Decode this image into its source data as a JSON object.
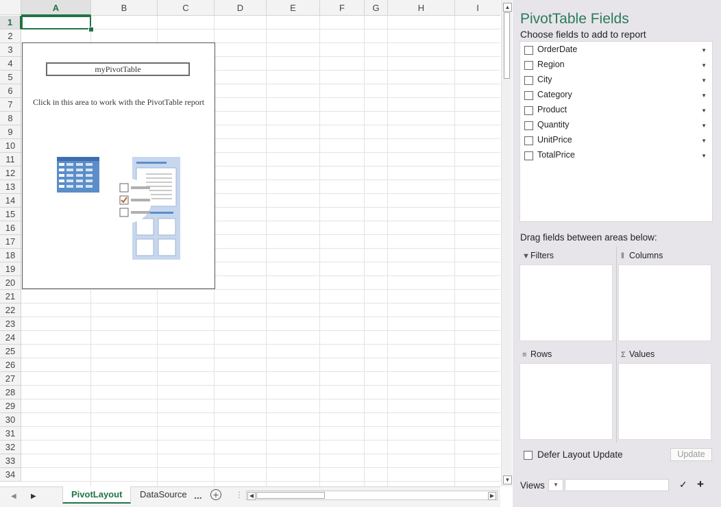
{
  "sheet": {
    "columns": [
      {
        "label": "A",
        "w": 102
      },
      {
        "label": "B",
        "w": 97
      },
      {
        "label": "C",
        "w": 83
      },
      {
        "label": "D",
        "w": 76
      },
      {
        "label": "E",
        "w": 78
      },
      {
        "label": "F",
        "w": 65
      },
      {
        "label": "G",
        "w": 34
      },
      {
        "label": "H",
        "w": 98
      },
      {
        "label": "I",
        "w": 67
      }
    ],
    "rows": [
      "1",
      "2",
      "3",
      "4",
      "5",
      "6",
      "7",
      "8",
      "9",
      "10",
      "11",
      "12",
      "13",
      "14",
      "15",
      "16",
      "17",
      "18",
      "19",
      "20",
      "21",
      "22",
      "23",
      "24",
      "25",
      "26",
      "27",
      "28",
      "29",
      "30",
      "31",
      "32",
      "33",
      "34"
    ],
    "selected_cell": "A1"
  },
  "pivot_placeholder": {
    "title": "myPivotTable",
    "hint": "Click in this area to work with the PivotTable report"
  },
  "tabs": {
    "items": [
      "PivotLayout",
      "DataSource"
    ],
    "active": "PivotLayout",
    "more_label": "...",
    "add_label": "+"
  },
  "panel": {
    "title": "PivotTable Fields",
    "subtitle": "Choose fields to add to report",
    "fields": [
      "OrderDate",
      "Region",
      "City",
      "Category",
      "Product",
      "Quantity",
      "UnitPrice",
      "TotalPrice"
    ],
    "drag_label": "Drag fields between areas below:",
    "areas": {
      "filters": {
        "label": "Filters",
        "icon": "filter-icon"
      },
      "columns": {
        "label": "Columns",
        "icon": "columns-icon"
      },
      "rows": {
        "label": "Rows",
        "icon": "rows-icon"
      },
      "values": {
        "label": "Values",
        "icon": "sigma-icon"
      }
    },
    "defer_label": "Defer Layout Update",
    "update_label": "Update",
    "views_label": "Views"
  },
  "colors": {
    "accent": "#217346",
    "panel_title": "#2d7a58",
    "panel_bg": "#e7e5ea"
  }
}
